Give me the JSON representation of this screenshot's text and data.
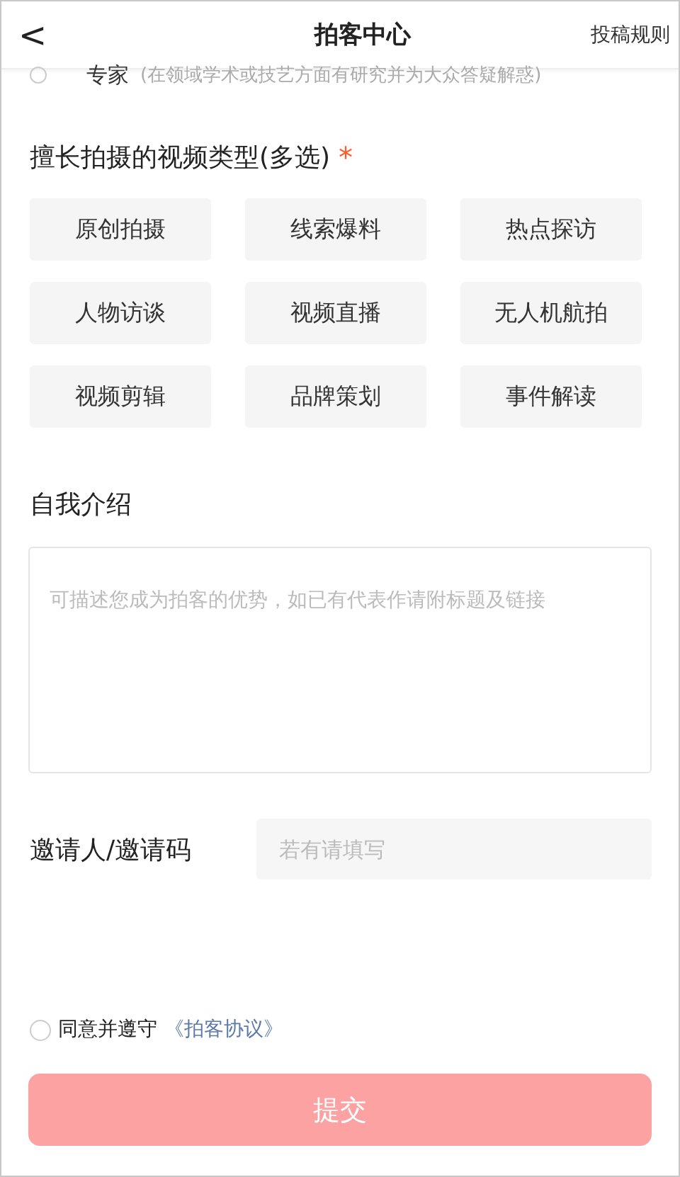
{
  "header": {
    "back": "<",
    "title": "拍客中心",
    "action": "投稿规则"
  },
  "role_option": {
    "label": "专家",
    "hint": "(在领域学术或技艺方面有研究并为大众答疑解惑)",
    "selected": false
  },
  "video_types": {
    "label": "擅长拍摄的视频类型(多选)",
    "required_mark": "*",
    "options": [
      {
        "label": "原创拍摄",
        "selected": false
      },
      {
        "label": "线索爆料",
        "selected": false
      },
      {
        "label": "热点探访",
        "selected": false
      },
      {
        "label": "人物访谈",
        "selected": false
      },
      {
        "label": "视频直播",
        "selected": false
      },
      {
        "label": "无人机航拍",
        "selected": false
      },
      {
        "label": "视频剪辑",
        "selected": false
      },
      {
        "label": "品牌策划",
        "selected": false
      },
      {
        "label": "事件解读",
        "selected": false
      }
    ]
  },
  "intro": {
    "label": "自我介绍",
    "placeholder": "可描述您成为拍客的优势，如已有代表作请附标题及链接"
  },
  "invite": {
    "label": "邀请人/邀请码",
    "placeholder": "若有请填写"
  },
  "agreement": {
    "checked": false,
    "text": "同意并遵守",
    "link": "《拍客协议》"
  },
  "submit": {
    "label": "提交",
    "disabled": true
  }
}
